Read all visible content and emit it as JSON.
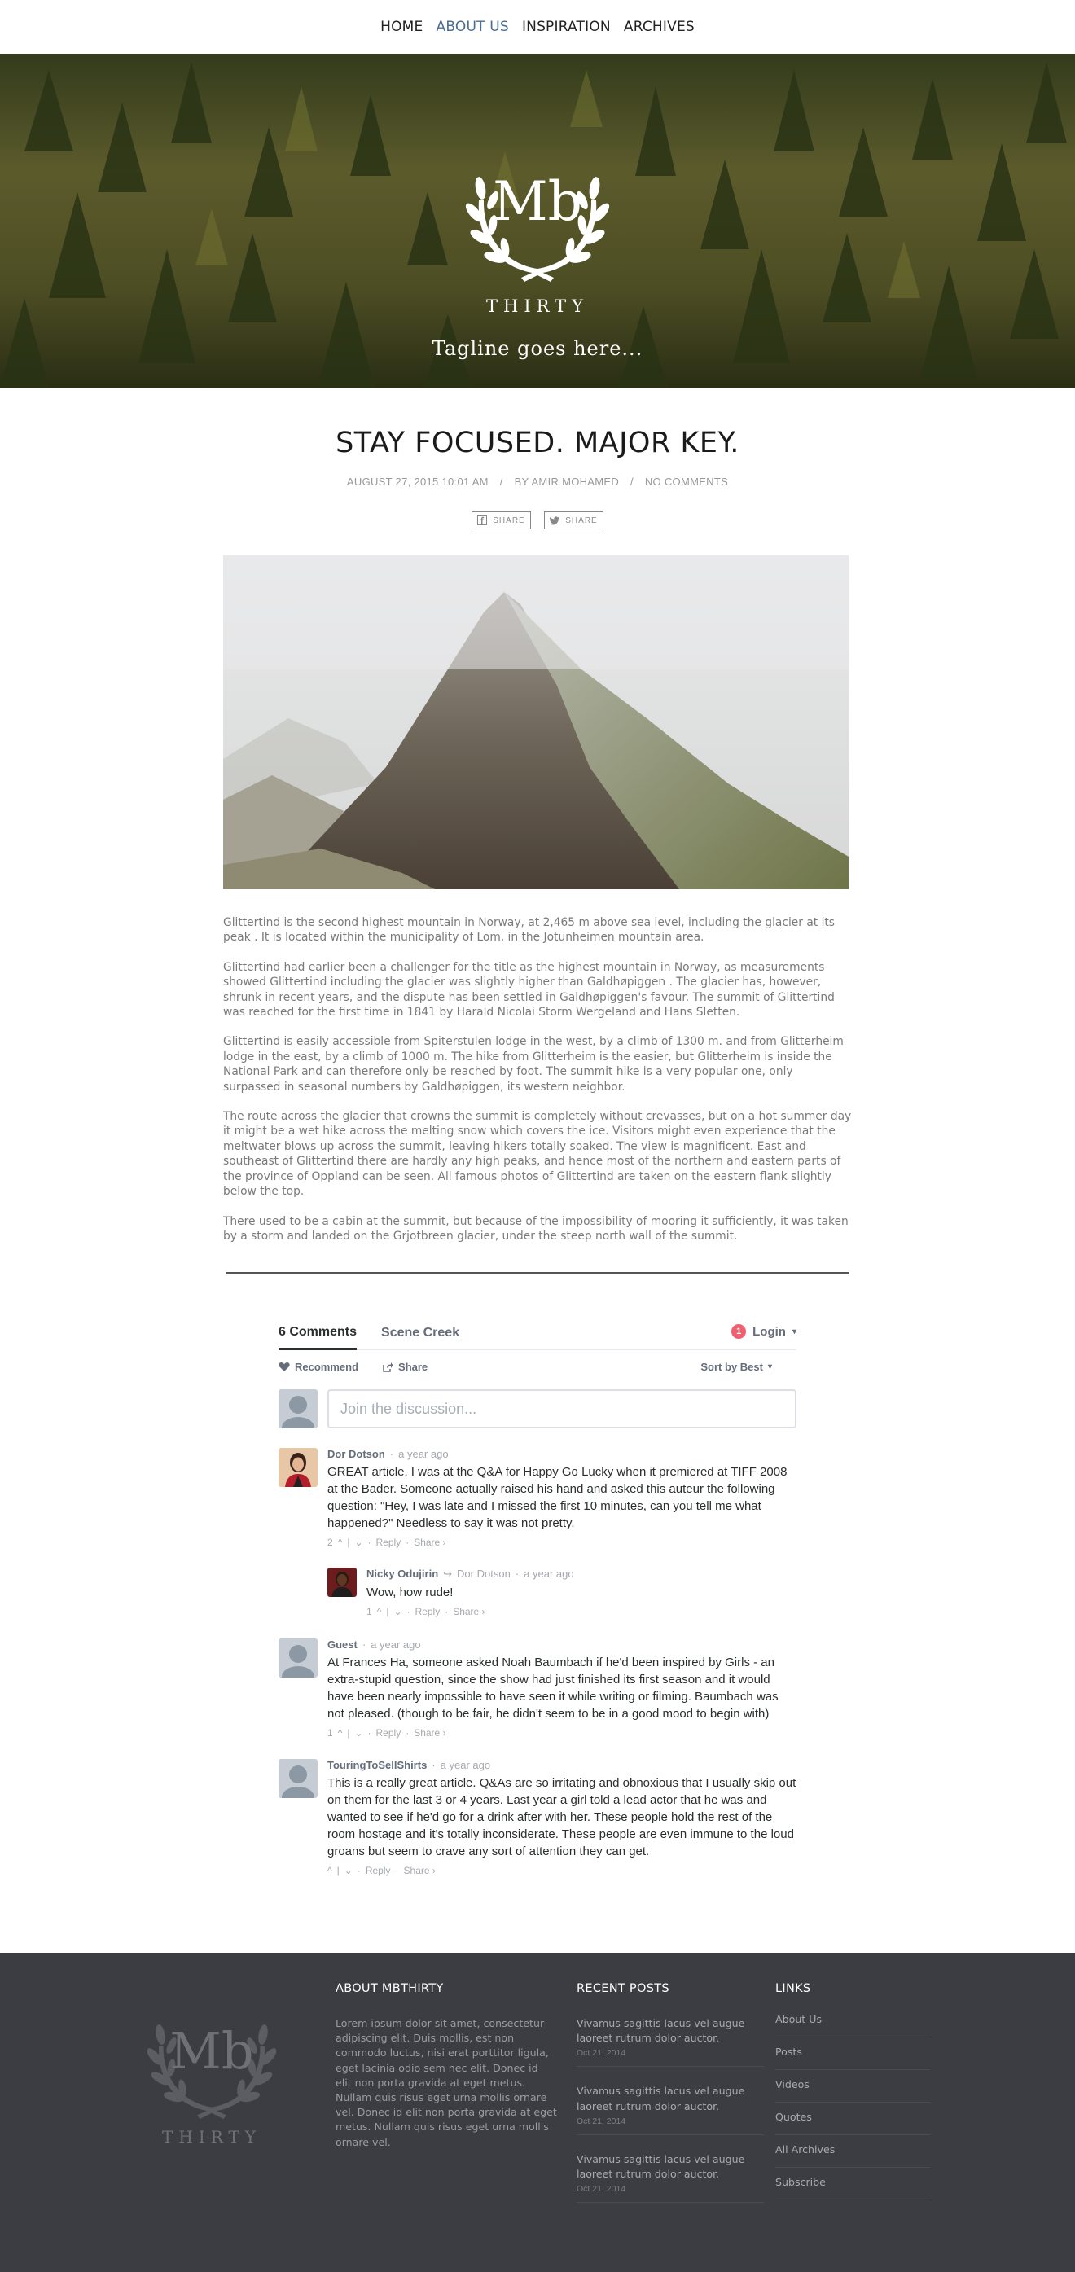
{
  "nav": {
    "items": [
      {
        "label": "HOME"
      },
      {
        "label": "ABOUT US"
      },
      {
        "label": "INSPIRATION"
      },
      {
        "label": "ARCHIVES"
      }
    ],
    "active_index": 1
  },
  "hero": {
    "logo_monogram": "Mb",
    "logo_sub": "THIRTY",
    "tagline": "Tagline goes here..."
  },
  "article": {
    "title": "STAY FOCUSED. MAJOR KEY.",
    "date": "AUGUST 27, 2015 10:01 AM",
    "author": "BY AMIR MOHAMED",
    "comments": "NO COMMENTS",
    "share_facebook": "SHARE",
    "share_twitter": "SHARE",
    "paragraphs": [
      "Glittertind is the second highest mountain in Norway, at 2,465 m above sea level, including the glacier at its peak . It is located within the municipality of Lom, in the Jotunheimen mountain area.",
      "Glittertind had earlier been a challenger for the title as the highest mountain in Norway, as measurements showed Glittertind including the glacier was slightly higher than Galdhøpiggen . The glacier has, however, shrunk in recent years, and the dispute has been settled in Galdhøpiggen's favour. The summit of Glittertind was reached for the first time in 1841 by Harald Nicolai Storm Wergeland and Hans Sletten.",
      "Glittertind is easily accessible from Spiterstulen lodge in the west, by a climb of 1300 m. and from Glitterheim lodge in the east, by a climb of 1000 m. The hike from Glitterheim is the easier, but Glitterheim is inside the National Park and can therefore only be reached by foot. The summit hike is a very popular one, only surpassed in seasonal numbers by Galdhøpiggen, its western neighbor.",
      "The route across the glacier that crowns the summit is completely without crevasses, but on a hot summer day it might be a wet hike across the melting snow which covers the ice. Visitors might even experience that the meltwater blows up across the summit, leaving hikers totally soaked. The view is magnificent. East and southeast of Glittertind there are hardly any high peaks, and hence most of the northern and eastern parts of the province of Oppland can be seen. All famous photos of Glittertind are taken on the eastern flank slightly below the top.",
      "There used to be a cabin at the summit, but because of the impossibility of mooring it sufficiently, it was taken by a storm and landed on the Grjotbreen glacier, under the steep north wall of the summit."
    ]
  },
  "comments": {
    "tab_count": "6 Comments",
    "tab_site": "Scene Creek",
    "login_badge": "1",
    "login": "Login",
    "recommend": "Recommend",
    "share": "Share",
    "sort": "Sort by Best",
    "placeholder": "Join the discussion...",
    "posts": [
      {
        "name": "Dor Dotson",
        "time": "a year ago",
        "text": "GREAT article. I was at the Q&A for Happy Go Lucky when it premiered at TIFF 2008 at the Bader. Someone actually raised his hand and asked this auteur the following question: \"Hey, I was late and I missed the first 10 minutes, can you tell me what happened?\" Needless to say it was not pretty.",
        "votes": "2",
        "reply": "Reply",
        "share": "Share ›"
      },
      {
        "name": "Nicky Odujirin",
        "reply_to": "Dor Dotson",
        "time": "a year ago",
        "text": "Wow, how rude!",
        "votes": "1",
        "reply": "Reply",
        "share": "Share ›"
      },
      {
        "name": "Guest",
        "time": "a year ago",
        "text": "At Frances Ha, someone asked Noah Baumbach if he'd been inspired by Girls - an extra-stupid question, since the show had just finished its first season and it would have been nearly impossible to have seen it while writing or filming. Baumbach was not pleased. (though to be fair, he didn't seem to be in a good mood to begin with)",
        "votes": "1",
        "reply": "Reply",
        "share": "Share ›"
      },
      {
        "name": "TouringToSellShirts",
        "time": "a year ago",
        "text": "This is a really great article. Q&As are so irritating and obnoxious that I usually skip out on them for the last 3 or 4 years. Last year a girl told a lead actor that he was and wanted to see if he'd go for a drink after with her. These people hold the rest of the room hostage and it's totally inconsiderate. These people are even immune to the loud groans but seem to crave any sort of attention they can get.",
        "votes": "",
        "reply": "Reply",
        "share": "Share ›"
      }
    ]
  },
  "footer": {
    "logo_monogram": "Mb",
    "logo_sub": "THIRTY",
    "about_title": "ABOUT MBTHIRTY",
    "about_text": "Lorem ipsum dolor sit amet, consectetur adipiscing elit. Duis mollis, est non commodo luctus, nisi erat porttitor ligula, eget lacinia odio sem nec elit. Donec id elit non porta gravida at eget metus. Nullam quis risus eget urna mollis ornare vel. Donec id elit non porta gravida at eget metus. Nullam quis risus eget urna mollis ornare vel.",
    "recent_title": "RECENT POSTS",
    "recent": [
      {
        "title": "Vivamus sagittis lacus vel augue laoreet rutrum dolor auctor.",
        "date": "Oct 21, 2014"
      },
      {
        "title": "Vivamus sagittis lacus vel augue laoreet rutrum dolor auctor.",
        "date": "Oct 21, 2014"
      },
      {
        "title": "Vivamus sagittis lacus vel augue laoreet rutrum dolor auctor.",
        "date": "Oct 21, 2014"
      }
    ],
    "links_title": "LINKS",
    "links": [
      "About Us",
      "Posts",
      "Videos",
      "Quotes",
      "All Archives",
      "Subscribe"
    ]
  },
  "colors": {
    "nav_active": "#4a6d93",
    "footer_bg": "#3c3d42",
    "badge": "#f05f70"
  }
}
